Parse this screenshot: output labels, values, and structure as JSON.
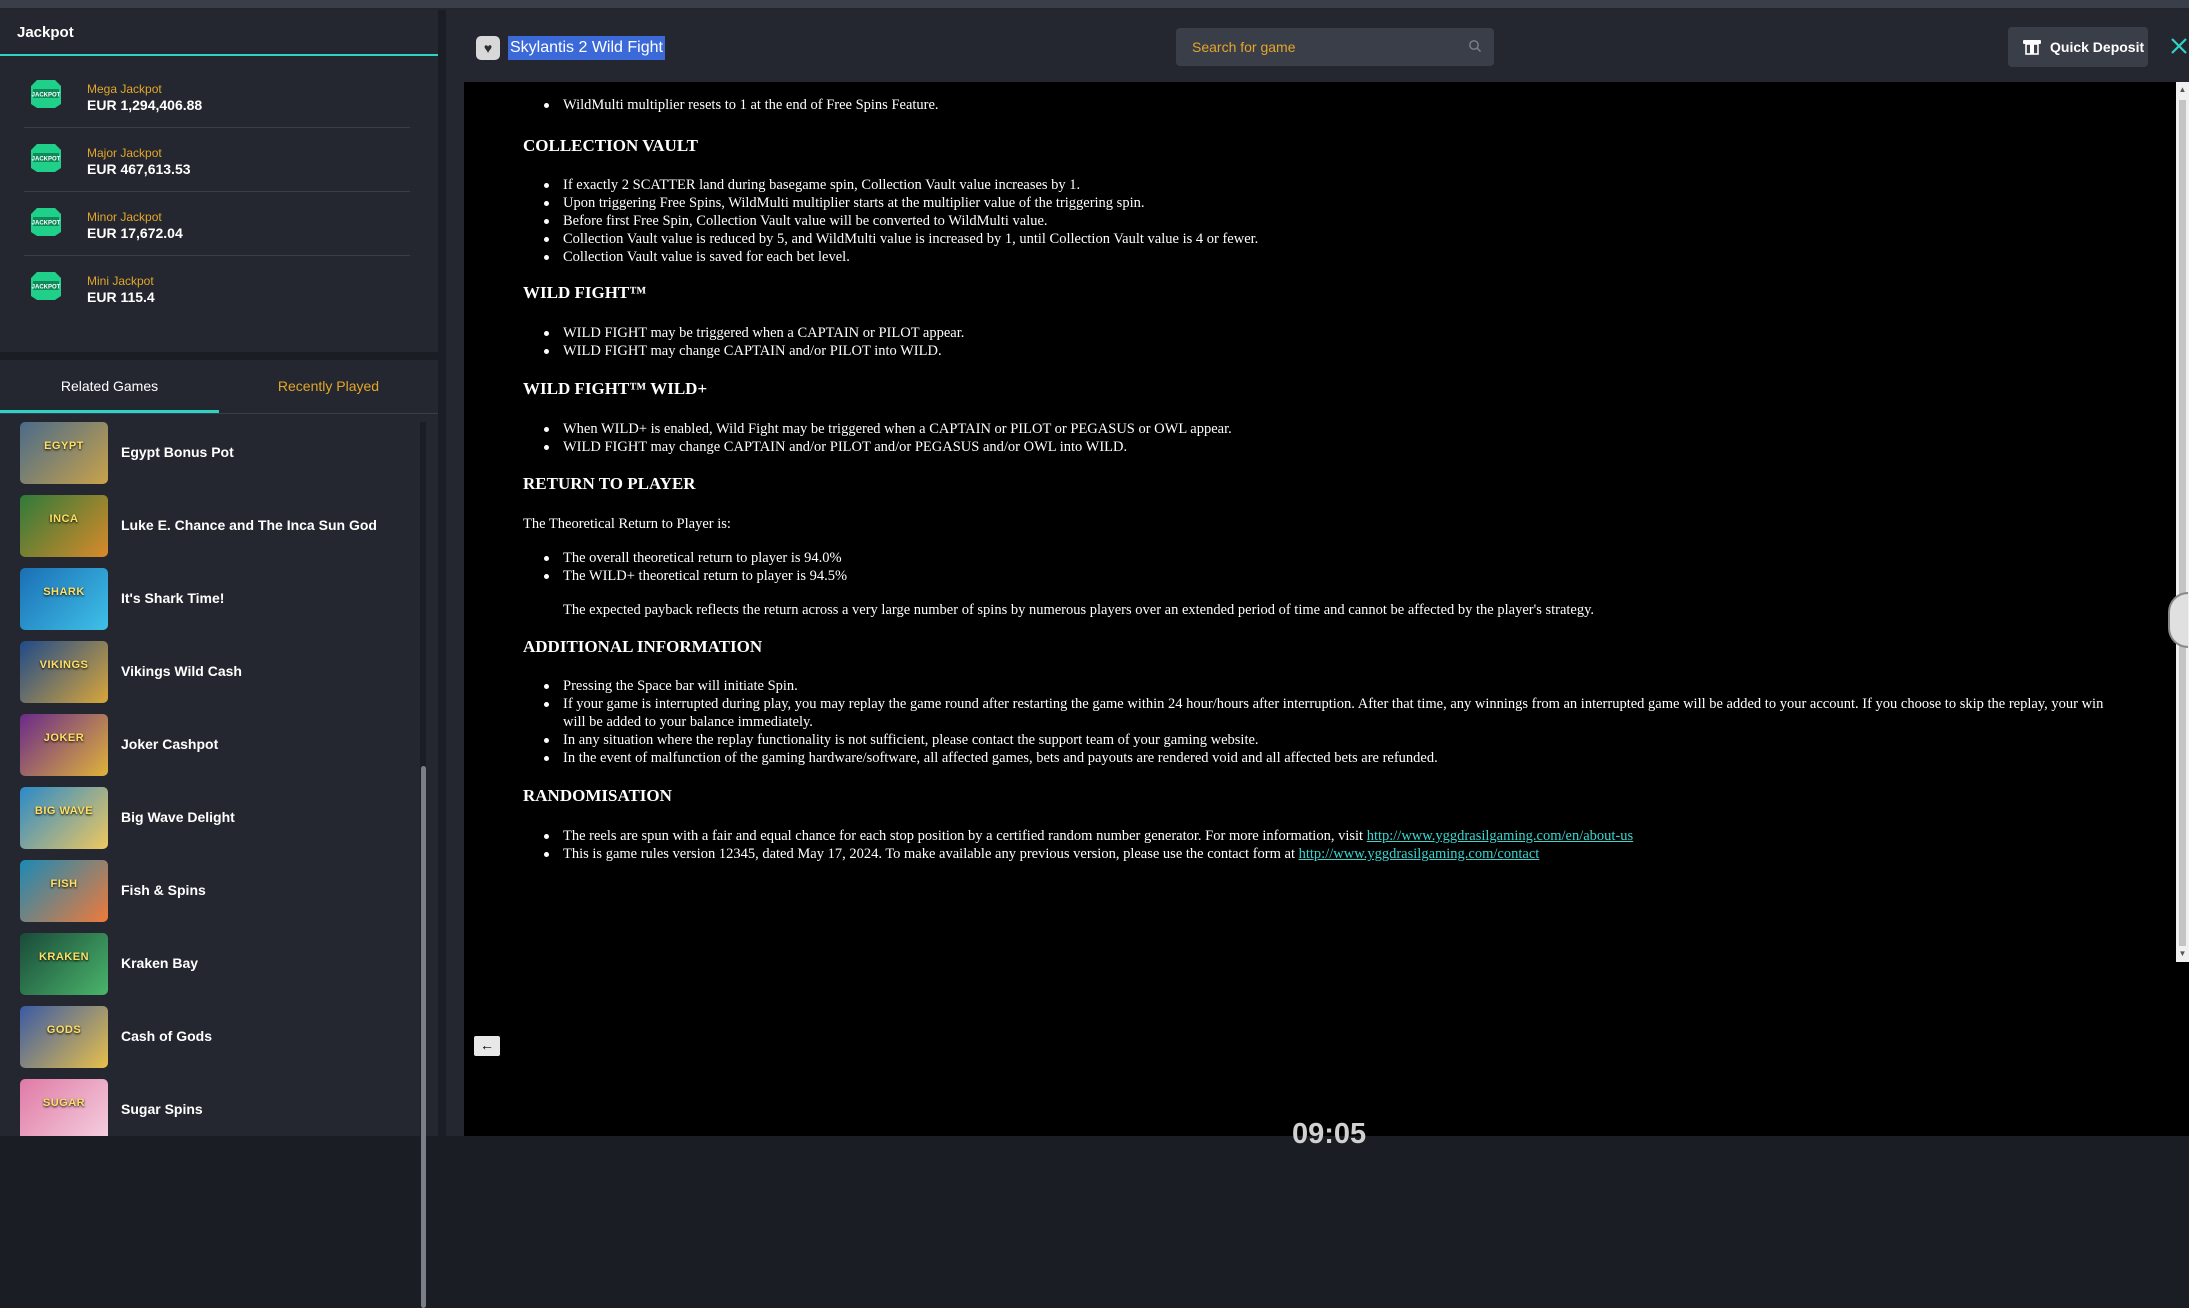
{
  "jackpot": {
    "title": "Jackpot",
    "items": [
      {
        "name": "Mega Jackpot",
        "value": "EUR 1,294,406.88"
      },
      {
        "name": "Major Jackpot",
        "value": "EUR 467,613.53"
      },
      {
        "name": "Minor Jackpot",
        "value": "EUR 17,672.04"
      },
      {
        "name": "Mini Jackpot",
        "value": "EUR 115.4"
      }
    ],
    "badge_text": "JACKPOT"
  },
  "tabs": {
    "related": "Related Games",
    "recent": "Recently Played"
  },
  "games": [
    {
      "name": "Egypt Bonus Pot",
      "thumb": "EGYPT",
      "c1": "#4a6b8a",
      "c2": "#c9a24a"
    },
    {
      "name": "Luke E. Chance and The Inca Sun God",
      "thumb": "INCA",
      "c1": "#2f7a3a",
      "c2": "#d98a2a"
    },
    {
      "name": "It's Shark Time!",
      "thumb": "SHARK",
      "c1": "#1a6fb5",
      "c2": "#3fc1e8"
    },
    {
      "name": "Vikings Wild Cash",
      "thumb": "VIKINGS",
      "c1": "#1f4a8a",
      "c2": "#d9a63a"
    },
    {
      "name": "Joker Cashpot",
      "thumb": "JOKER",
      "c1": "#6a2a8a",
      "c2": "#e0b33a"
    },
    {
      "name": "Big Wave Delight",
      "thumb": "BIG WAVE",
      "c1": "#2a8ac9",
      "c2": "#f0c860"
    },
    {
      "name": "Fish & Spins",
      "thumb": "FISH",
      "c1": "#1a8ab5",
      "c2": "#f07a3a"
    },
    {
      "name": "Kraken Bay",
      "thumb": "KRAKEN",
      "c1": "#1a4a3a",
      "c2": "#4ab56a"
    },
    {
      "name": "Cash of Gods",
      "thumb": "GODS",
      "c1": "#3a5aa5",
      "c2": "#e8c04a"
    },
    {
      "name": "Sugar Spins",
      "thumb": "SUGAR",
      "c1": "#e07aa5",
      "c2": "#f5d0e0"
    }
  ],
  "header": {
    "title": "Skylantis 2 Wild Fight",
    "search_placeholder": "Search for game",
    "quick_deposit": "Quick Deposit"
  },
  "rules": {
    "top_item": "WildMulti multiplier resets to 1 at the end of Free Spins Feature.",
    "collection_vault": {
      "heading": "COLLECTION VAULT",
      "items": [
        "If exactly 2 SCATTER land during basegame spin, Collection Vault value increases by 1.",
        "Upon triggering Free Spins, WildMulti multiplier starts at the multiplier value of the triggering spin.",
        "Before first Free Spin, Collection Vault value will be converted to WildMulti value.",
        "Collection Vault value is reduced by 5, and WildMulti value is increased by 1, until Collection Vault value is 4 or fewer.",
        "Collection Vault value is saved for each bet level."
      ]
    },
    "wild_fight": {
      "heading": "WILD FIGHT™",
      "items": [
        "WILD FIGHT may be triggered when a CAPTAIN or PILOT appear.",
        "WILD FIGHT may change CAPTAIN and/or PILOT into WILD."
      ]
    },
    "wild_fight_plus": {
      "heading": "WILD FIGHT™ WILD+",
      "items": [
        "When WILD+ is enabled, Wild Fight may be triggered when a CAPTAIN or PILOT or PEGASUS or OWL appear.",
        "WILD FIGHT may change CAPTAIN and/or PILOT and/or PEGASUS and/or OWL into WILD."
      ]
    },
    "rtp": {
      "heading": "RETURN TO PLAYER",
      "intro": "The Theoretical Return to Player is:",
      "items": [
        "The overall theoretical return to player is 94.0%",
        "The WILD+ theoretical return to player is 94.5%"
      ],
      "note": "The expected payback reflects the return across a very large number of spins by numerous players over an extended period of time and cannot be affected by the player's strategy."
    },
    "additional": {
      "heading": "ADDITIONAL INFORMATION",
      "items": [
        "Pressing the Space bar will initiate Spin.",
        "If your game is interrupted during play, you may replay the game round after restarting the game within 24 hour/hours after interruption. After that time, any winnings from an interrupted game will be added to your account. If you choose to skip the replay, your win will be added to your balance immediately.",
        "In any situation where the replay functionality is not sufficient, please contact the support team of your gaming website.",
        "In the event of malfunction of the gaming hardware/software, all affected games, bets and payouts are rendered void and all affected bets are refunded."
      ]
    },
    "randomisation": {
      "heading": "RANDOMISATION",
      "item1_text": "The reels are spun with a fair and equal chance for each stop position by a certified random number generator. For more information, visit ",
      "item1_link": "http://www.yggdrasilgaming.com/en/about-us",
      "item2_text": "This is game rules version 12345, dated May 17, 2024. To make available any previous version, please use the contact form at ",
      "item2_link": "http://www.yggdrasilgaming.com/contact"
    }
  },
  "back_label": "←",
  "clock": "09:05",
  "colors": {
    "accent": "#2fd3c3",
    "gold": "#e3a62a",
    "link": "#3bd6d0"
  }
}
